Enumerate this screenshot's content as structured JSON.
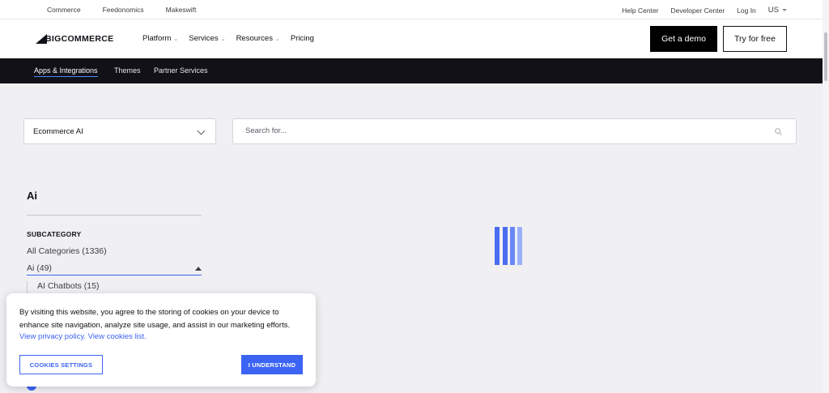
{
  "utility_bar": {
    "links": [
      "Commerce",
      "Feedonomics",
      "Makeswift"
    ],
    "right_links": [
      "Help Center",
      "Developer Center",
      "Log In"
    ],
    "language": "US"
  },
  "main_nav": {
    "logo_text": "BIGCOMMERCE",
    "menu": [
      {
        "label": "Platform",
        "has_dropdown": true
      },
      {
        "label": "Services",
        "has_dropdown": true
      },
      {
        "label": "Resources",
        "has_dropdown": true
      },
      {
        "label": "Pricing",
        "has_dropdown": false
      }
    ],
    "demo_button": "Get a demo",
    "try_button": "Try for free"
  },
  "sub_nav": {
    "tabs": [
      {
        "label": "Apps & Integrations",
        "active": true
      },
      {
        "label": "Themes",
        "active": false
      },
      {
        "label": "Partner Services",
        "active": false
      }
    ]
  },
  "filters": {
    "category_select": "Ecommerce AI",
    "search_placeholder": "Search for..."
  },
  "sidebar": {
    "category_title": "Ai",
    "subcategory_label": "SUBCATEGORY",
    "all_categories": "All Categories (1336)",
    "selected": "Ai (49)",
    "sub_items": [
      "AI Chatbots (15)"
    ]
  },
  "cookie_banner": {
    "message": "By visiting this website, you agree to the storing of cookies on your device to enhance site navigation, analyze site usage, and assist in our marketing efforts.",
    "privacy_link": "View privacy policy.",
    "cookies_link": "View cookies list.",
    "settings_button": "COOKIES SETTINGS",
    "accept_button": "I UNDERSTAND"
  },
  "colors": {
    "accent": "#3c64f4",
    "dark_nav": "#121118",
    "page_bg": "#f0f0f3",
    "loader": [
      "#4a6cf0",
      "#4a6cf0",
      "#6a88f4",
      "#9ab0f8"
    ]
  },
  "icons": {
    "logo": "bigcommerce-logo",
    "search": "search-icon",
    "chevron": "chevron-down-icon",
    "loader": "loading-spinner-icon"
  }
}
